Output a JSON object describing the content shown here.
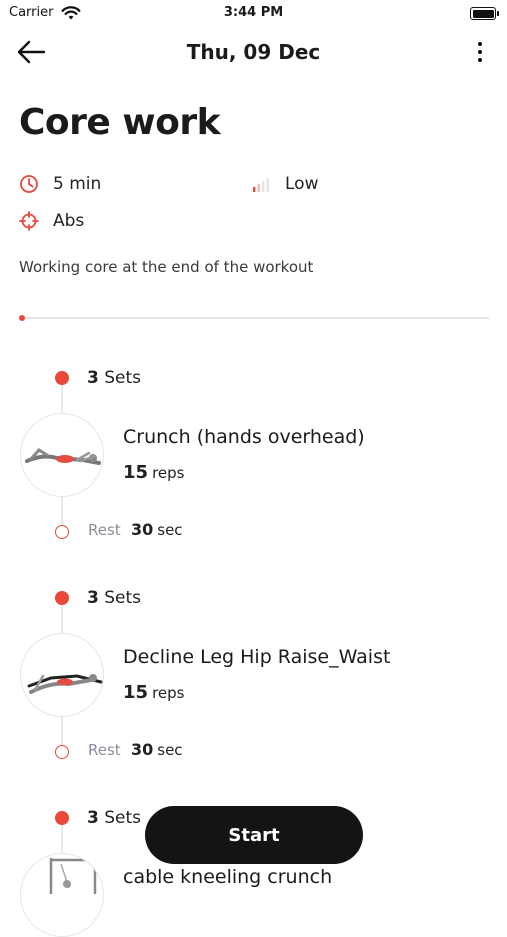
{
  "status_bar": {
    "carrier": "Carrier",
    "time": "3:44 PM"
  },
  "nav": {
    "title": "Thu, 09 Dec"
  },
  "workout": {
    "title": "Core work",
    "duration": "5 min",
    "intensity": "Low",
    "target": "Abs",
    "description": "Working core at the end of the workout"
  },
  "exercises": [
    {
      "sets_count": "3",
      "sets_label": "Sets",
      "name": "Crunch (hands overhead)",
      "reps_count": "15",
      "reps_label": "reps",
      "rest_label": "Rest",
      "rest_value": "30",
      "rest_unit": "sec"
    },
    {
      "sets_count": "3",
      "sets_label": "Sets",
      "name": "Decline Leg Hip Raise_Waist",
      "reps_count": "15",
      "reps_label": "reps",
      "rest_label": "Rest",
      "rest_value": "30",
      "rest_unit": "sec"
    },
    {
      "sets_count": "3",
      "sets_label": "Sets",
      "name": "cable kneeling crunch"
    }
  ],
  "start_label": "Start",
  "colors": {
    "accent": "#e8473c",
    "button_bg": "#141414"
  },
  "icons": [
    "back-arrow-icon",
    "more-vertical-icon",
    "clock-icon",
    "signal-bars-icon",
    "target-icon"
  ]
}
